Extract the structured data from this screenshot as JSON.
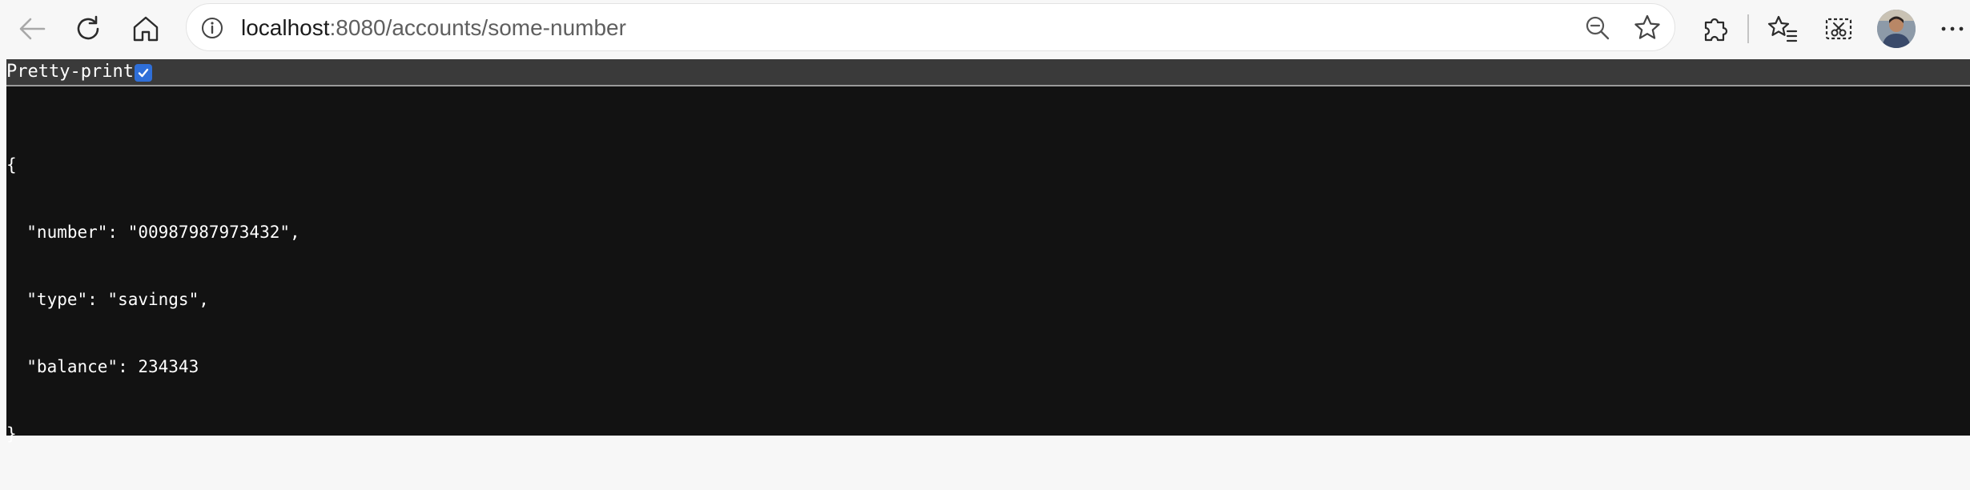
{
  "browser": {
    "url_host": "localhost",
    "url_rest": ":8080/accounts/some-number",
    "icons": {
      "back": "back-arrow-icon",
      "reload": "reload-icon",
      "home": "home-icon",
      "site_info": "info-icon",
      "zoom": "zoom-out-icon",
      "favorite": "star-icon",
      "extensions": "puzzle-icon",
      "favorites_list": "favorites-icon",
      "screenshot": "web-capture-icon",
      "profile": "avatar",
      "menu": "more-icon"
    }
  },
  "page": {
    "pretty_print_label": "Pretty-print",
    "pretty_print_checked": true,
    "json_lines": [
      "{",
      "  \"number\": \"00987987973432\",",
      "  \"type\": \"savings\",",
      "  \"balance\": 234343",
      "}"
    ]
  },
  "colors": {
    "toolbar_bg": "#f7f7f7",
    "viewport_bg": "#121212",
    "pretty_print_bar_bg": "#3a3a3a",
    "checkbox_accent": "#2f6fd8"
  }
}
